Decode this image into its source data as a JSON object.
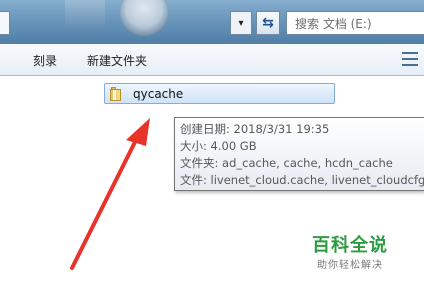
{
  "address_bar": {
    "dropdown_glyph": "▾",
    "refresh_icon": "refresh-icon",
    "search_placeholder": "搜索 文档 (E:)"
  },
  "toolbar": {
    "partial_item": "▾",
    "burn_label": "刻录",
    "new_folder_label": "新建文件夹",
    "views_icon": "views-icon"
  },
  "file_list": {
    "items": [
      {
        "name": "qycache",
        "icon": "folder-icon",
        "selected": true
      }
    ]
  },
  "tooltip": {
    "lines": [
      "创建日期: 2018/3/31 19:35",
      "大小: 4.00 GB",
      "文件夹: ad_cache, cache, hcdn_cache",
      "文件: livenet_cloud.cache, livenet_cloudcfg.",
      ""
    ]
  },
  "annotation": {
    "arrow_color": "#e8332a"
  },
  "watermark": {
    "title": "百科全说",
    "subtitle": "助你轻松解决",
    "color": "#2c9c43"
  }
}
